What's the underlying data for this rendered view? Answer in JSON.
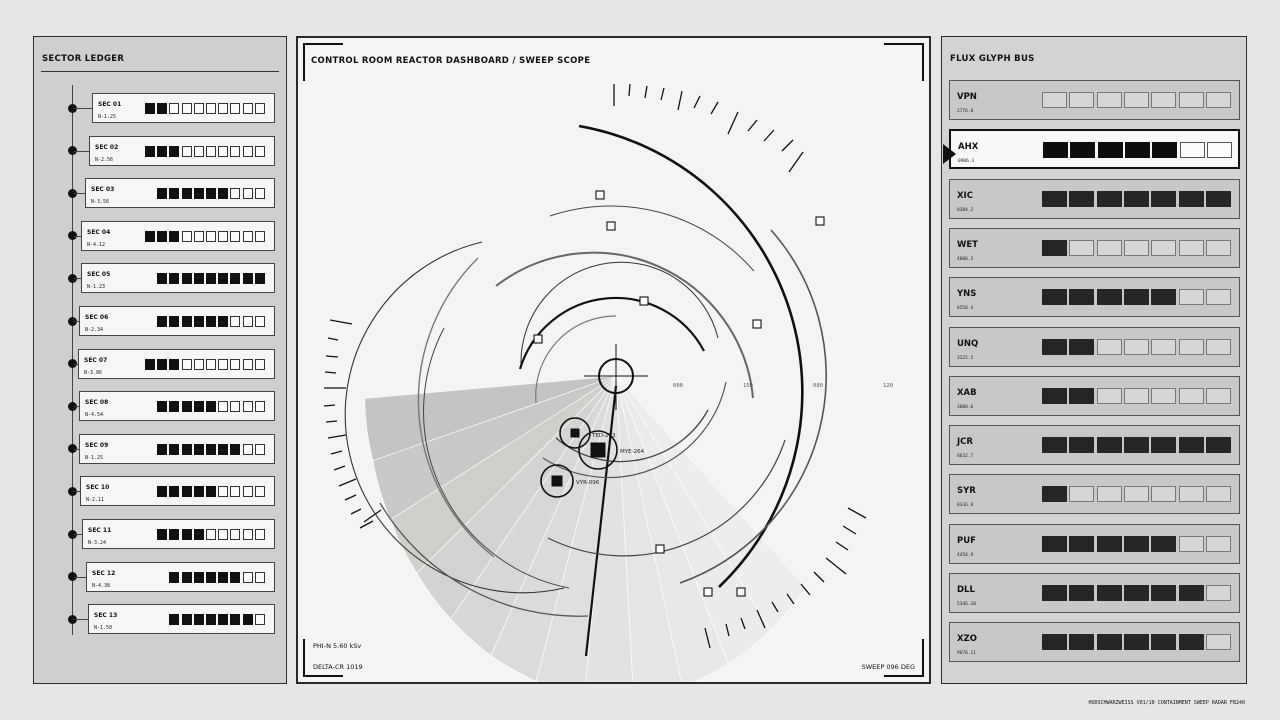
{
  "sector_ledger": {
    "title": "SECTOR LEDGER",
    "sectors": [
      {
        "name": "SEC 01",
        "value": "N-1.25",
        "filled": 2,
        "total": 10
      },
      {
        "name": "SEC 02",
        "value": "N-2.56",
        "filled": 3,
        "total": 10
      },
      {
        "name": "SEC 03",
        "value": "N-3.56",
        "filled": 6,
        "total": 9
      },
      {
        "name": "SEC 04",
        "value": "N-4.12",
        "filled": 3,
        "total": 10
      },
      {
        "name": "SEC 05",
        "value": "N-1.23",
        "filled": 9,
        "total": 9
      },
      {
        "name": "SEC 06",
        "value": "N-2.34",
        "filled": 6,
        "total": 9
      },
      {
        "name": "SEC 07",
        "value": "N-3.86",
        "filled": 3,
        "total": 10
      },
      {
        "name": "SEC 08",
        "value": "N-4.54",
        "filled": 5,
        "total": 9
      },
      {
        "name": "SEC 09",
        "value": "N-1.25",
        "filled": 7,
        "total": 9
      },
      {
        "name": "SEC 10",
        "value": "N-2.11",
        "filled": 5,
        "total": 9
      },
      {
        "name": "SEC 11",
        "value": "N-3.24",
        "filled": 4,
        "total": 9
      },
      {
        "name": "SEC 12",
        "value": "N-4.38",
        "filled": 6,
        "total": 8
      },
      {
        "name": "SEC 13",
        "value": "N-1.50",
        "filled": 7,
        "total": 8
      }
    ]
  },
  "scope": {
    "title": "CONTROL ROOM REACTOR DASHBOARD  /  SWEEP SCOPE",
    "range_labels": [
      "000",
      "150",
      "080",
      "120"
    ],
    "contacts": [
      {
        "label": "TED-203"
      },
      {
        "label": "MYE-264"
      },
      {
        "label": "VYR-096"
      }
    ],
    "readout_phi": "PHI-N 5.60 kSv",
    "readout_delta": "DELTA-CR 1019",
    "readout_sweep": "SWEEP 096 DEG",
    "sweep_angle_deg": 96
  },
  "flux_bus": {
    "title": "FLUX GLYPH BUS",
    "active_index": 1,
    "rows": [
      {
        "name": "VPN",
        "value": "2776.8",
        "filled": 0
      },
      {
        "name": "AHX",
        "value": "0906.1",
        "filled": 5
      },
      {
        "name": "XIC",
        "value": "8384.2",
        "filled": 7
      },
      {
        "name": "WET",
        "value": "4886.3",
        "filled": 1
      },
      {
        "name": "YNS",
        "value": "8558.4",
        "filled": 5
      },
      {
        "name": "UNQ",
        "value": "3225.5",
        "filled": 2
      },
      {
        "name": "XAB",
        "value": "3080.6",
        "filled": 2
      },
      {
        "name": "JCR",
        "value": "8632.7",
        "filled": 7
      },
      {
        "name": "SYR",
        "value": "8336.8",
        "filled": 1
      },
      {
        "name": "PUF",
        "value": "4456.9",
        "filled": 5
      },
      {
        "name": "DLL",
        "value": "5346.10",
        "filled": 6
      },
      {
        "name": "XZO",
        "value": "9676.11",
        "filled": 6
      }
    ]
  },
  "footer": {
    "credit": "HUDSCHWARZWEISS  V01/10  CONTAINMENT SWEEP RADAR  FB240"
  }
}
